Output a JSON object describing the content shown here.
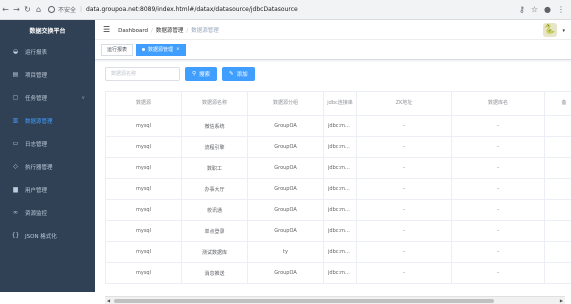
{
  "browser": {
    "insecure_label": "不安全",
    "url": "data.groupoa.net:8089/index.html#/datax/datasource/jdbcDatasource"
  },
  "sidebar": {
    "title": "数据交换平台",
    "items": [
      {
        "label": "运行报表",
        "icon": "dashboard-icon"
      },
      {
        "label": "项目管理",
        "icon": "project-icon"
      },
      {
        "label": "任务管理",
        "icon": "task-icon",
        "expandable": true
      },
      {
        "label": "数据源管理",
        "icon": "datasource-icon",
        "active": true
      },
      {
        "label": "日志管理",
        "icon": "log-icon"
      },
      {
        "label": "执行器管理",
        "icon": "executor-icon"
      },
      {
        "label": "用户管理",
        "icon": "user-icon"
      },
      {
        "label": "资源监控",
        "icon": "monitor-icon"
      },
      {
        "label": "JSON 格式化",
        "icon": "json-icon"
      }
    ]
  },
  "breadcrumb": [
    "Dashboard",
    "数据源管理",
    "数据源管理"
  ],
  "tags": [
    {
      "label": "运行报表",
      "active": false
    },
    {
      "label": "数据源管理",
      "active": true
    }
  ],
  "toolbar": {
    "search_placeholder": "数据源名称",
    "search_label": "搜索",
    "add_label": "添加"
  },
  "table": {
    "columns": [
      "数据源",
      "数据源名称",
      "数据源分组",
      "jdbc连接串",
      "ZK地址",
      "数据库名",
      "备"
    ],
    "rows": [
      [
        "mysql",
        "微信系统",
        "GroupOA",
        "jdbc:m...",
        "-",
        "-"
      ],
      [
        "mysql",
        "流程引擎",
        "GroupOA",
        "jdbc:m...",
        "-",
        "-"
      ],
      [
        "mysql",
        "数职工",
        "GroupOA",
        "jdbc:m...",
        "-",
        "-"
      ],
      [
        "mysql",
        "办事大厅",
        "GroupOA",
        "jdbc:m...",
        "-",
        "-"
      ],
      [
        "mysql",
        "校讯通",
        "GroupOA",
        "jdbc:m...",
        "-",
        "-"
      ],
      [
        "mysql",
        "单点登录",
        "GroupOA",
        "jdbc:m...",
        "-",
        "-"
      ],
      [
        "mysql",
        "测试数据库",
        "ty",
        "jdbc:m...",
        "-",
        "-"
      ],
      [
        "mysql",
        "消息推送",
        "GroupOA",
        "jdbc:m...",
        "-",
        "-"
      ]
    ]
  },
  "colors": {
    "sidebar_bg": "#304156",
    "sidebar_text": "#bfcbd9",
    "accent": "#409eff"
  }
}
